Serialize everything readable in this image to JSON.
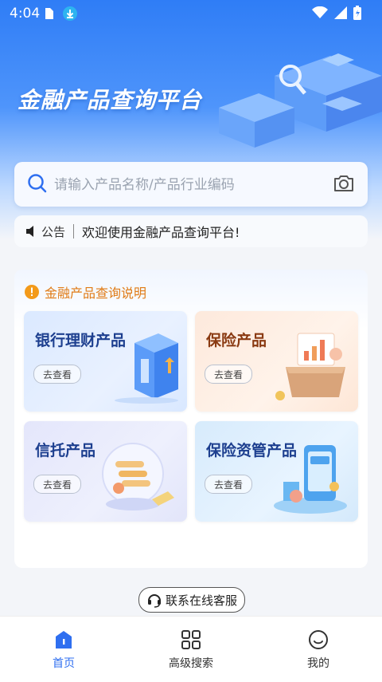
{
  "status_bar": {
    "time": "4:04"
  },
  "hero": {
    "title": "金融产品查询平台"
  },
  "search": {
    "placeholder": "请输入产品名称/产品行业编码"
  },
  "notice": {
    "label": "公告",
    "text": "欢迎使用金融产品查询平台!"
  },
  "panel": {
    "header": "金融产品查询说明",
    "cards": [
      {
        "title": "银行理财产品",
        "button": "去查看"
      },
      {
        "title": "保险产品",
        "button": "去查看"
      },
      {
        "title": "信托产品",
        "button": "去查看"
      },
      {
        "title": "保险资管产品",
        "button": "去查看"
      }
    ]
  },
  "contact": {
    "label": "联系在线客服"
  },
  "tabbar": {
    "items": [
      {
        "label": "首页",
        "icon": "home-icon",
        "active": true
      },
      {
        "label": "高级搜索",
        "icon": "grid-icon",
        "active": false
      },
      {
        "label": "我的",
        "icon": "smile-icon",
        "active": false
      }
    ]
  },
  "colors": {
    "brand_blue": "#2f7df6",
    "tab_active": "#2f6ff0",
    "notice_orange": "#e07b16"
  }
}
